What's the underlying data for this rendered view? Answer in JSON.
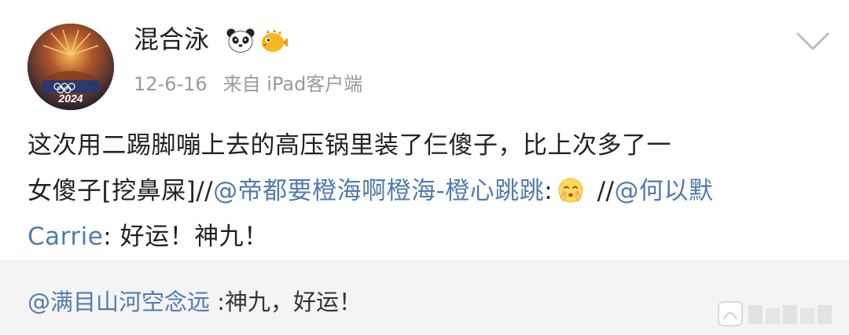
{
  "post": {
    "author": {
      "name": "混合泳",
      "avatar_text": "2024"
    },
    "badges": [
      "panda-icon",
      "pufferfish-icon"
    ],
    "meta": {
      "date": "12-6-16",
      "source": "来自 iPad客户端"
    },
    "body": {
      "line1": "这次用二踢脚嘣上去的高压锅里装了仨傻子，比上次多了一",
      "line2_start": "女傻子[挖鼻屎]//",
      "mention1": "@帝都要橙海啊橙海-橙心跳跳",
      "colon1": ":",
      "sep2": " //",
      "mention2_part1": "@何以默",
      "mention2_part2": "Carrie",
      "tail": ": 好运！神九！"
    },
    "menu_icon": "chevron-down-icon"
  },
  "repost": {
    "mention": "@满目山河空念远",
    "text": " :神九，好运！"
  },
  "watermark_icon": "platform-watermark-icon"
}
